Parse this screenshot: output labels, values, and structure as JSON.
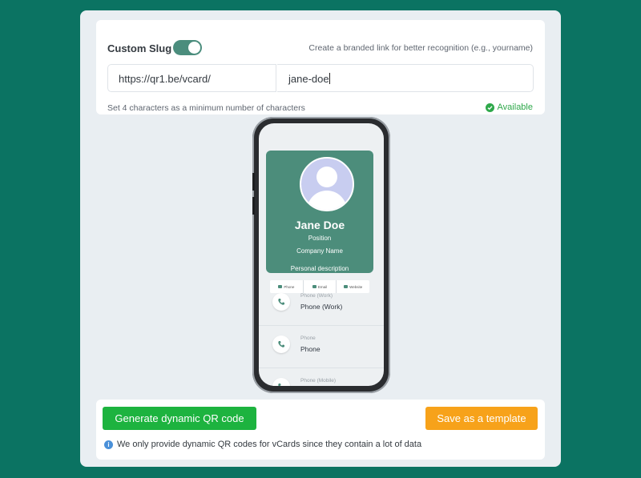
{
  "slug": {
    "title": "Custom Slug",
    "toggle_on": true,
    "hint": "Create a branded link for better recognition (e.g., yourname)",
    "url_prefix": "https://qr1.be/vcard/",
    "slug_value": "jane-doe",
    "min_hint": "Set 4 characters as a minimum number of characters",
    "status": "Available"
  },
  "preview": {
    "name": "Jane Doe",
    "position": "Position",
    "company": "Company Name",
    "description": "Personal description",
    "quick_actions": [
      "Phone",
      "Email",
      "Website"
    ],
    "contacts": [
      {
        "small": "Phone (Work)",
        "main": "Phone (Work)"
      },
      {
        "small": "Phone",
        "main": "Phone"
      },
      {
        "small": "Phone (Mobile)",
        "main": ""
      }
    ]
  },
  "actions": {
    "generate_label": "Generate dynamic QR code",
    "save_label": "Save as a template",
    "info": "We only provide dynamic QR codes for vCards since they contain a lot of data"
  },
  "colors": {
    "background": "#0b7362",
    "accent": "#4c8d7b",
    "generate": "#1db33f",
    "save": "#f7a21a",
    "available": "#2ea84a"
  }
}
